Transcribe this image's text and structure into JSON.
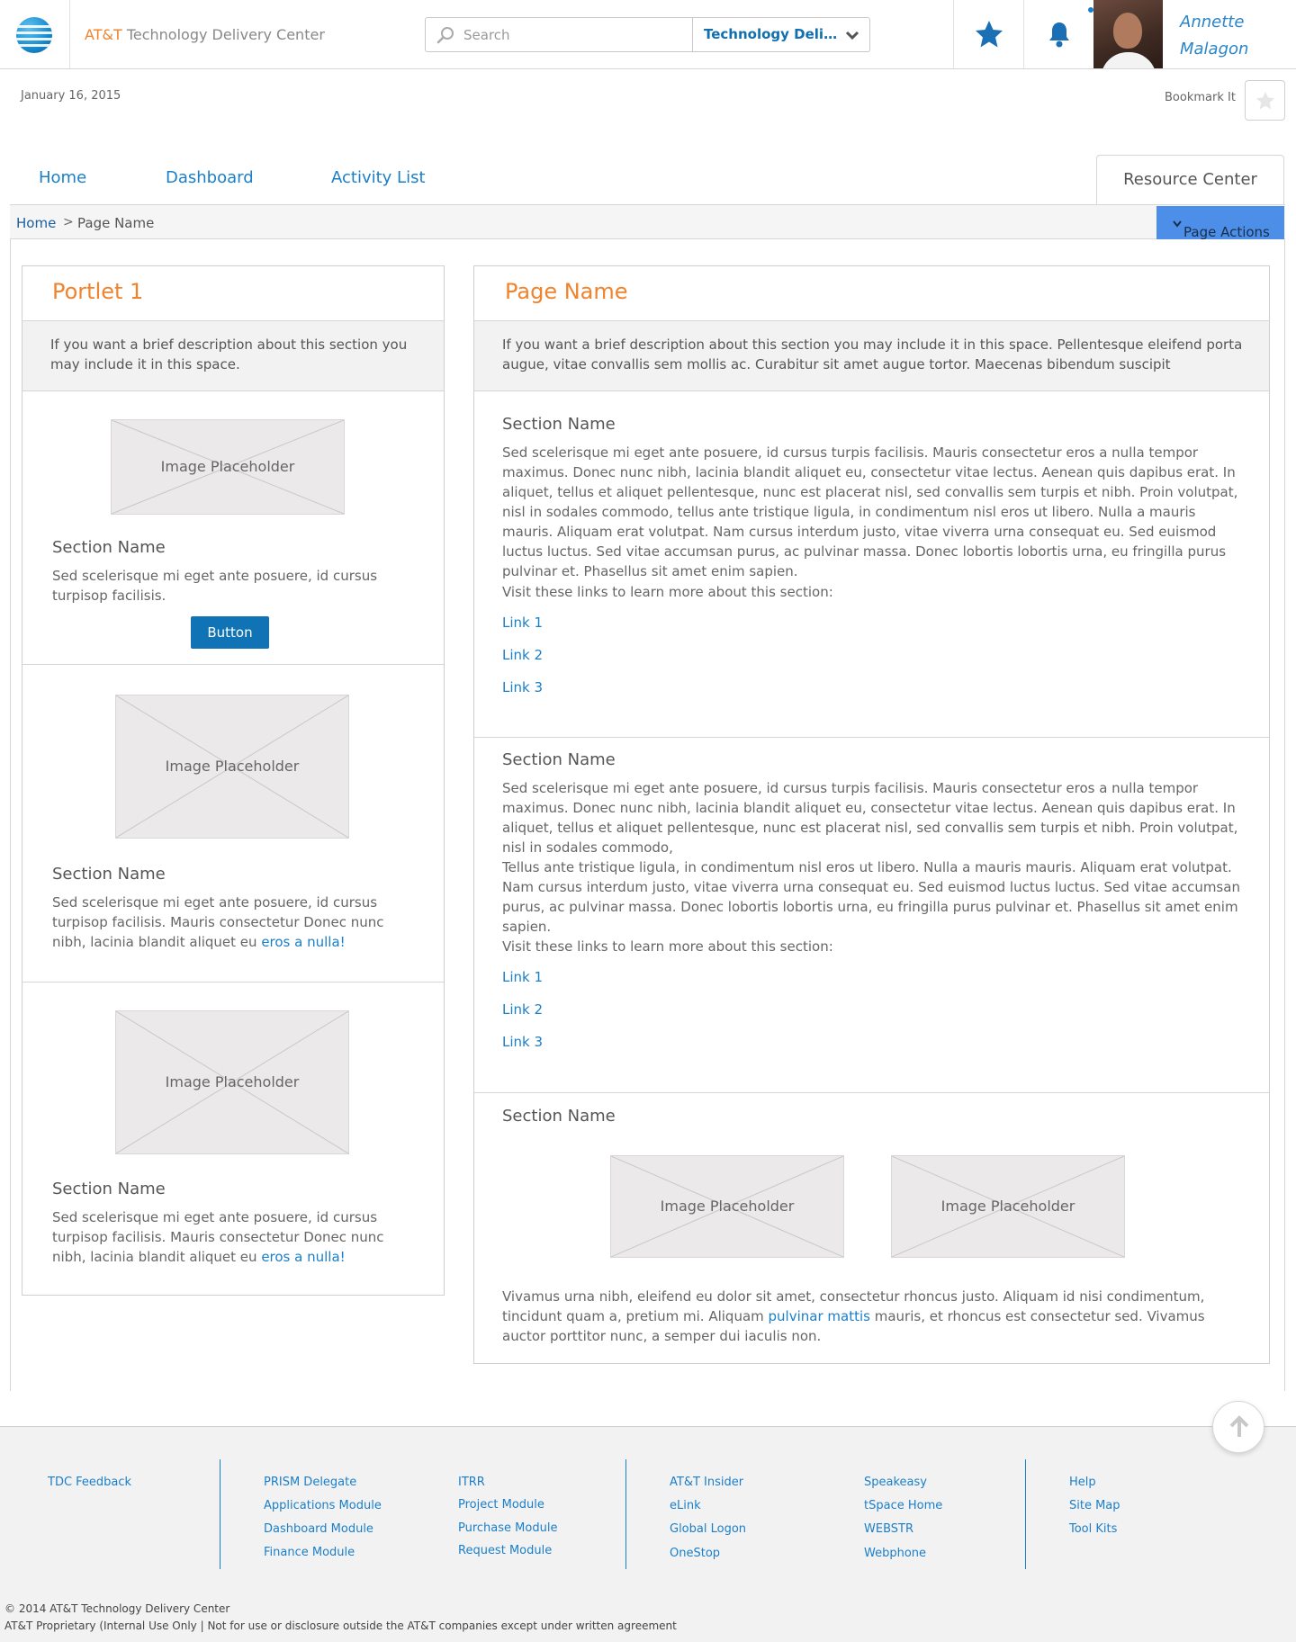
{
  "header": {
    "brand": "AT&T",
    "app_title": "Technology Delivery Center",
    "search_placeholder": "Search",
    "site_select": "Technology Deliv...",
    "user_name_first": "Annette",
    "user_name_last": "Malagon"
  },
  "subheader": {
    "date": "January 16, 2015",
    "bookmark_label": "Bookmark It"
  },
  "nav": {
    "home": "Home",
    "dashboard": "Dashboard",
    "activity": "Activity List",
    "resource": "Resource Center"
  },
  "breadcrumb": {
    "home": "Home",
    "sep": ">",
    "page": "Page Name",
    "actions": "Page Actions"
  },
  "left_portlet": {
    "title": "Portlet 1",
    "description": "If you want a brief description about this section you may include it in this space.",
    "placeholder": "Image Placeholder",
    "sections": [
      {
        "title": "Section Name",
        "body": "Sed scelerisque mi eget ante posuere, id cursus turpisop facilisis.",
        "button": "Button"
      },
      {
        "title": "Section Name",
        "body": "Sed scelerisque mi eget ante posuere, id cursus turpisop facilisis. Mauris consectetur Donec nunc nibh, lacinia blandit aliquet eu ",
        "link": "eros a nulla!"
      },
      {
        "title": "Section Name",
        "body": "Sed scelerisque mi eget ante posuere, id cursus turpisop facilisis. Mauris consectetur Donec nunc nibh, lacinia blandit aliquet eu ",
        "link": "eros a nulla!"
      }
    ]
  },
  "right_portlet": {
    "title": "Page Name",
    "description": "If you want a brief description about this section you may include it in this space. Pellentesque eleifend porta augue, vitae convallis sem mollis ac. Curabitur sit amet augue tortor. Maecenas bibendum suscipit",
    "placeholder": "Image Placeholder",
    "section1": {
      "title": "Section Name",
      "body": "Sed scelerisque mi eget ante posuere, id cursus turpis facilisis. Mauris consectetur eros a nulla tempor maximus. Donec nunc nibh, lacinia blandit aliquet eu, consectetur vitae lectus. Aenean quis dapibus erat. In aliquet, tellus et aliquet pellentesque, nunc est placerat nisl, sed convallis sem turpis et nibh. Proin volutpat, nisl in sodales commodo, tellus ante tristique ligula, in condimentum nisl eros ut libero. Nulla a mauris mauris. Aliquam erat volutpat. Nam cursus interdum justo, vitae viverra urna consequat eu. Sed euismod luctus luctus. Sed vitae accumsan purus, ac pulvinar massa. Donec lobortis lobortis urna, eu fringilla purus pulvinar et. Phasellus sit amet enim sapien.",
      "links_intro": "Visit these links to learn more about this section:",
      "links": [
        "Link 1",
        "Link 2",
        "Link 3"
      ]
    },
    "section2": {
      "title": "Section Name",
      "body1": "Sed scelerisque mi eget ante posuere, id cursus turpis facilisis. Mauris consectetur eros a nulla tempor maximus. Donec nunc nibh, lacinia blandit aliquet eu, consectetur vitae lectus. Aenean quis dapibus erat. In aliquet, tellus et aliquet pellentesque, nunc est placerat nisl, sed convallis sem turpis et nibh. Proin volutpat, nisl in sodales commodo,",
      "body2": "Tellus ante tristique ligula, in condimentum nisl eros ut libero. Nulla a mauris mauris. Aliquam erat volutpat. Nam cursus interdum justo, vitae viverra urna consequat eu. Sed euismod luctus luctus. Sed vitae accumsan purus, ac pulvinar massa. Donec lobortis lobortis urna, eu fringilla purus pulvinar et. Phasellus sit amet enim sapien.",
      "links_intro": "Visit these links to learn more about this section:",
      "links": [
        "Link 1",
        "Link 2",
        "Link 3"
      ]
    },
    "section3": {
      "title": "Section Name",
      "body_a": "Vivamus urna nibh, eleifend eu dolor sit amet, consectetur rhoncus justo. Aliquam id nisi condimentum, tincidunt quam a, pretium mi. Aliquam ",
      "body_link": "pulvinar mattis",
      "body_b": " mauris, et rhoncus est consectetur sed. Vivamus auctor porttitor nunc, a semper dui iaculis non."
    }
  },
  "footer": {
    "col1": [
      "TDC Feedback"
    ],
    "col2": [
      "PRISM Delegate",
      "Applications Module",
      "Dashboard Module",
      "Finance Module"
    ],
    "col3": [
      "ITRR",
      "Project Module",
      "Purchase Module",
      "Request Module"
    ],
    "col4": [
      "AT&T Insider",
      "eLink",
      "Global Logon",
      "OneStop"
    ],
    "col5": [
      "Speakeasy",
      "tSpace Home",
      "WEBSTR",
      "Webphone"
    ],
    "col6": [
      "Help",
      "Site Map",
      "Tool Kits"
    ],
    "copyright": "© 2014 AT&T Technology Delivery Center",
    "proprietary": "AT&T Proprietary (Internal Use Only  |  Not for use or disclosure outside the AT&T companies except under written agreement"
  },
  "colors": {
    "accent_blue": "#1a7fc9",
    "title_orange": "#f0832b",
    "page_actions_bg": "#4d8fe8"
  }
}
